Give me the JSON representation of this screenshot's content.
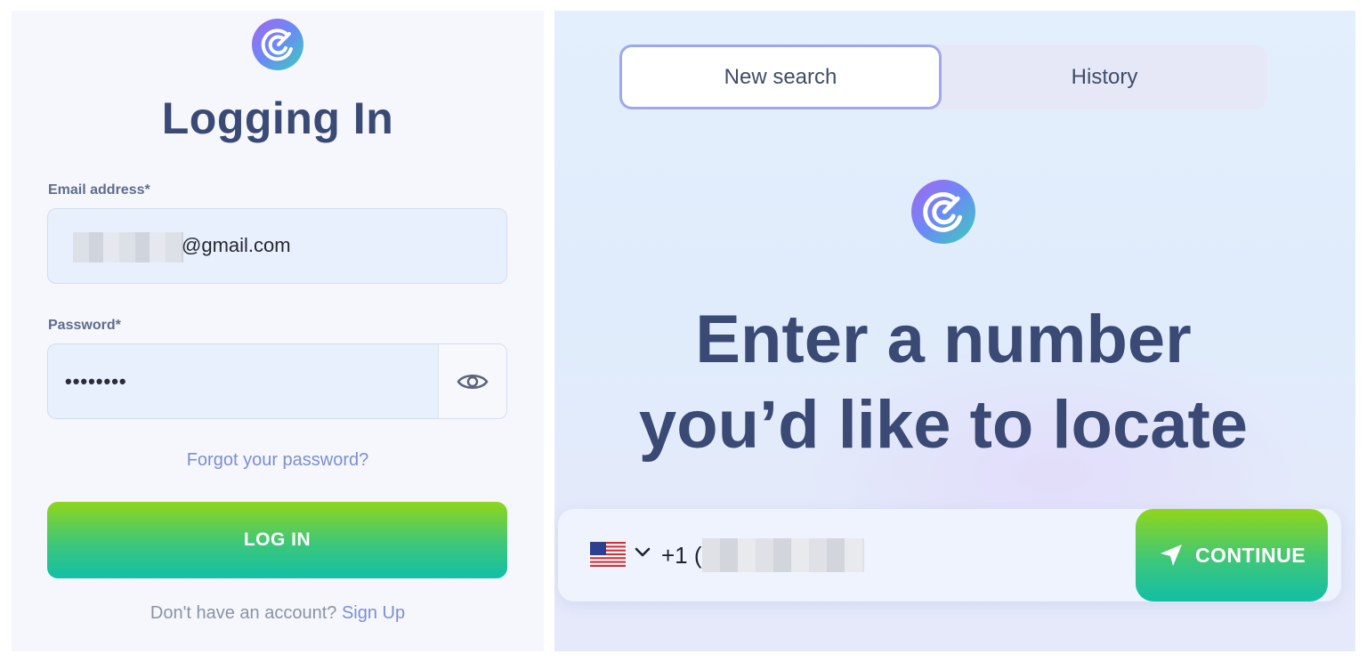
{
  "login": {
    "title": "Logging In",
    "email_label": "Email address*",
    "email_value": "@gmail.com",
    "password_label": "Password*",
    "password_value": "••••••••",
    "forgot_link": "Forgot your password?",
    "login_button": "LOG IN",
    "signup_prompt": "Don't have an account?",
    "signup_link": "Sign Up"
  },
  "search": {
    "tabs": [
      {
        "label": "New search",
        "active": true
      },
      {
        "label": "History",
        "active": false
      }
    ],
    "headline_line1": "Enter a number",
    "headline_line2": "you’d like to locate",
    "country": "us-flag-icon",
    "dial_code": "+1 (",
    "continue_button": "CONTINUE"
  },
  "icons": {
    "logo": "app-logo-icon",
    "eye": "eye-icon",
    "chevron": "chevron-down-icon",
    "navigation": "navigation-arrow-icon"
  },
  "colors": {
    "title": "#3a4a74",
    "link": "#7c8ed6",
    "accent_green": "#8fd61b",
    "accent_teal": "#12bfa6",
    "tab_border": "#9ea8ec"
  }
}
